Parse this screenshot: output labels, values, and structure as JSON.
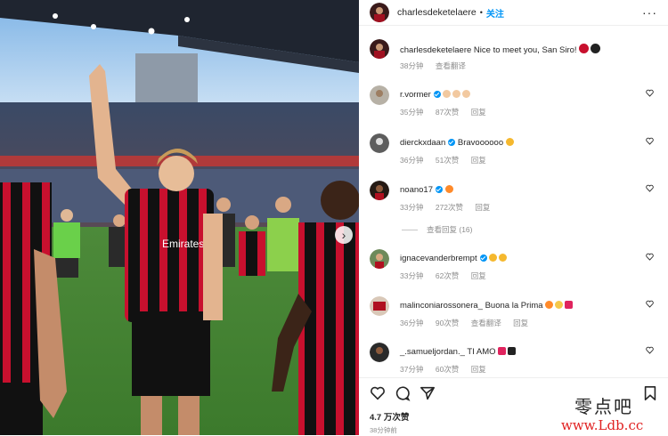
{
  "post": {
    "username": "charlesdeketelaere",
    "follow_label": "关注",
    "dot": "•",
    "more": "···"
  },
  "caption": {
    "username": "charlesdeketelaere",
    "text": "Nice to meet you, San Siro!",
    "time": "38分钟",
    "translate": "查看翻译"
  },
  "comments": [
    {
      "username": "r.vormer",
      "verified": true,
      "text": "",
      "time": "35分钟",
      "likes": "87次赞",
      "reply": "回复",
      "translate": ""
    },
    {
      "username": "dierckxdaan",
      "verified": true,
      "text": "Bravoooooo",
      "time": "36分钟",
      "likes": "51次赞",
      "reply": "回复",
      "translate": ""
    },
    {
      "username": "noano17",
      "verified": true,
      "text": "",
      "time": "33分钟",
      "likes": "272次赞",
      "reply": "回复",
      "translate": ""
    },
    {
      "username": "ignacevanderbrempt",
      "verified": true,
      "text": "",
      "time": "33分钟",
      "likes": "62次赞",
      "reply": "回复",
      "translate": ""
    },
    {
      "username": "malinconiarossonera_",
      "verified": false,
      "text": "Buona la Prima",
      "time": "36分钟",
      "likes": "90次赞",
      "reply": "回复",
      "translate": "查看翻译"
    },
    {
      "username": "_.samueljordan._",
      "verified": false,
      "text": "TI AMO",
      "time": "37分钟",
      "likes": "60次赞",
      "reply": "回复",
      "translate": ""
    }
  ],
  "view_replies": "查看回复 (16)",
  "footer": {
    "likes": "4.7 万次赞",
    "time_ago": "38分钟前"
  },
  "watermark": {
    "line1": "零点吧",
    "line2": "www.Ldb.cc"
  },
  "colors": {
    "accent": "#0095f6",
    "milan_red": "#c8102e",
    "heart_red": "#ed4956"
  }
}
